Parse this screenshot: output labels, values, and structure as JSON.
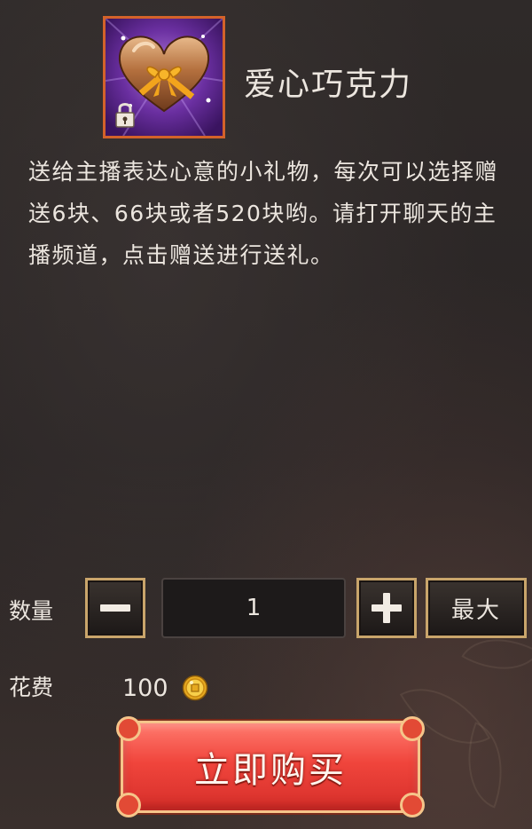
{
  "item": {
    "name": "爱心巧克力",
    "icon": "heart-chocolate-locked-icon",
    "description": "送给主播表达心意的小礼物，每次可以选择赠送6块、66块或者520块哟。请打开聊天的主播频道，点击赠送进行送礼。"
  },
  "quantity": {
    "label": "数量",
    "value": "1",
    "decrease_icon": "minus-icon",
    "increase_icon": "plus-icon",
    "max_label": "最大"
  },
  "cost": {
    "label": "花费",
    "value": "100",
    "currency_icon": "gold-coin-icon"
  },
  "buy_button": {
    "label": "立即购买"
  },
  "colors": {
    "panel_bg": "#2b2626",
    "text": "#ece6df",
    "button_border": "#c9a56b",
    "buy_button": "#f0453c",
    "icon_frame": "#d3622a"
  }
}
